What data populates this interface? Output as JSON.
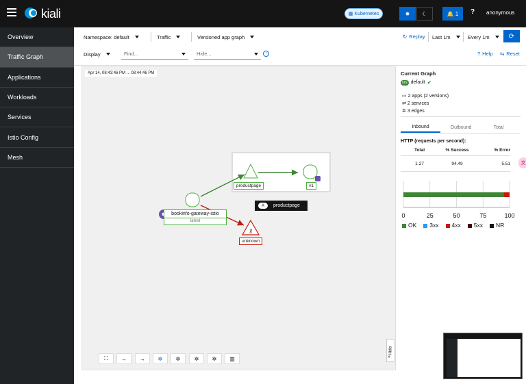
{
  "header": {
    "logo_text": "kiali",
    "cluster_badge": "Kubernetes",
    "notifications_count": "1",
    "user": "anonymous"
  },
  "sidebar": {
    "items": [
      {
        "label": "Overview"
      },
      {
        "label": "Traffic Graph",
        "active": true
      },
      {
        "label": "Applications"
      },
      {
        "label": "Workloads"
      },
      {
        "label": "Services"
      },
      {
        "label": "Istio Config"
      },
      {
        "label": "Mesh"
      }
    ]
  },
  "toolbar": {
    "namespace_label": "Namespace:",
    "namespace_value": "default",
    "traffic_label": "Traffic",
    "graph_type": "Versioned app graph",
    "replay_label": "Replay",
    "duration": "Last 1m",
    "refresh_interval": "Every 1m",
    "display_label": "Display",
    "find_placeholder": "Find...",
    "hide_placeholder": "Hide...",
    "help_label": "Help",
    "reset_label": "Reset"
  },
  "graph": {
    "timestamp": "Apr 14, 08:43:46 PM ... 08:44:46 PM",
    "nodes": {
      "productpage_label": "productpage",
      "v1_label": "v1",
      "gateway_label": "bookinfo-gateway-istio",
      "gateway_version": "latest",
      "unknown_label": "unknown",
      "app_box_badge": "A",
      "app_box_label": "productpage"
    },
    "hide_label": "Hide",
    "colors": {
      "success_edge": "#3e8635",
      "error_edge": "#c9190b",
      "node_border": "#4cb140"
    }
  },
  "panel": {
    "title": "Current Graph",
    "ns_badge": "NS",
    "namespace": "default",
    "summary": [
      "2 apps (2 versions)",
      "2 services",
      "3 edges"
    ],
    "tabs": [
      "Inbound",
      "Outbound",
      "Total"
    ],
    "http_title": "HTTP (requests per second):",
    "table_headers": [
      "Total",
      "% Success",
      "% Error"
    ],
    "table_values": [
      "1.27",
      "94.49",
      "5.51"
    ],
    "legend": [
      {
        "label": "OK",
        "color": "#3e8635"
      },
      {
        "label": "3xx",
        "color": "#2b9af3"
      },
      {
        "label": "4xx",
        "color": "#c9190b"
      },
      {
        "label": "5xx",
        "color": "#470000"
      },
      {
        "label": "NR",
        "color": "#151515"
      }
    ]
  },
  "chart_data": {
    "type": "bar",
    "orientation": "horizontal-stacked",
    "categories": [
      "HTTP"
    ],
    "series": [
      {
        "name": "OK",
        "values": [
          94.49
        ]
      },
      {
        "name": "4xx",
        "values": [
          5.51
        ]
      }
    ],
    "xlim": [
      0,
      100
    ],
    "xticks": [
      "0",
      "25",
      "50",
      "75",
      "100"
    ]
  }
}
